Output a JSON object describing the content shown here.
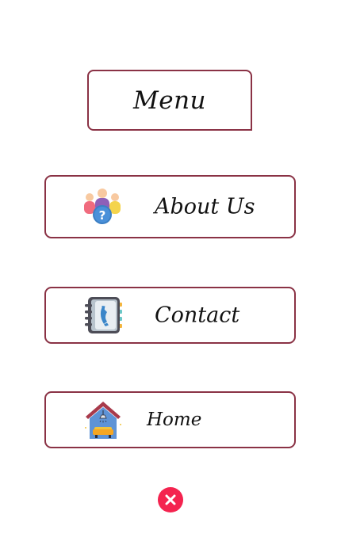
{
  "menu": {
    "title": "Menu",
    "items": [
      {
        "label": "About Us",
        "icon": "team-question-icon"
      },
      {
        "label": "Contact",
        "icon": "phone-book-icon"
      },
      {
        "label": "Home",
        "icon": "house-icon"
      }
    ],
    "close_icon": "close-icon"
  },
  "colors": {
    "border": "#8a3245",
    "close_button": "#f4234f",
    "text": "#111111"
  }
}
